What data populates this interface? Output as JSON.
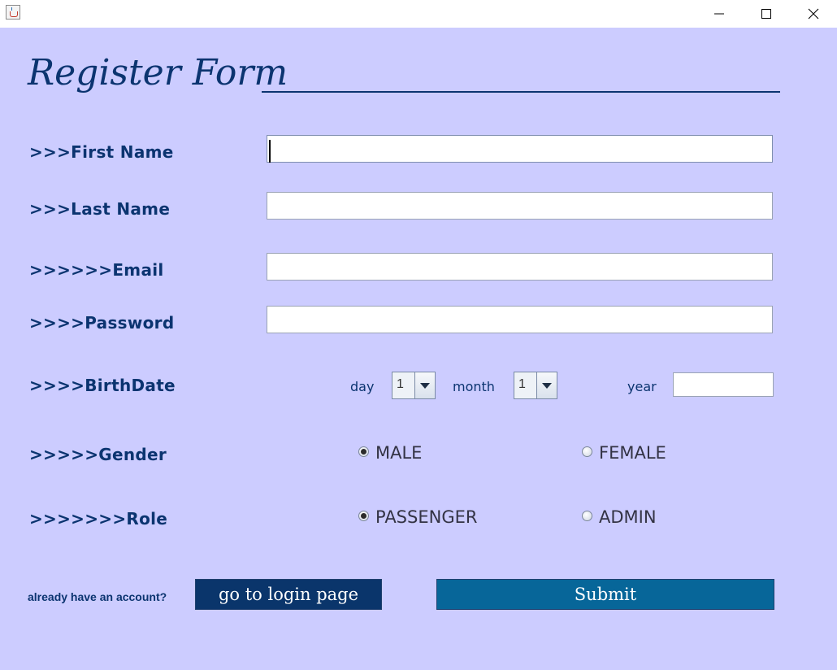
{
  "window": {
    "app_icon": "java-cup-icon",
    "controls": [
      "minimize-icon",
      "maximize-icon",
      "close-icon"
    ]
  },
  "form": {
    "title": "Register Form",
    "fields": {
      "first_name": {
        "label": ">>>First Name",
        "value": ""
      },
      "last_name": {
        "label": ">>>Last Name",
        "value": ""
      },
      "email": {
        "label": ">>>>>>Email",
        "value": ""
      },
      "password": {
        "label": ">>>>Password",
        "value": ""
      }
    },
    "birthdate": {
      "label": ">>>>BirthDate",
      "day_label": "day",
      "day_value": "1",
      "month_label": "month",
      "month_value": "1",
      "year_label": "year",
      "year_value": ""
    },
    "gender": {
      "label": ">>>>>Gender",
      "options": [
        {
          "label": "MALE",
          "checked": true
        },
        {
          "label": "FEMALE",
          "checked": false
        }
      ]
    },
    "role": {
      "label": ">>>>>>>Role",
      "options": [
        {
          "label": "PASSENGER",
          "checked": true
        },
        {
          "label": "ADMIN",
          "checked": false
        }
      ]
    },
    "footer": {
      "hint": "already have an account?",
      "login_button": "go to login page",
      "submit_button": "Submit"
    }
  },
  "colors": {
    "background": "#ccccff",
    "text": "#0b3470",
    "login_button": "#0a356b",
    "submit_button": "#076699"
  }
}
